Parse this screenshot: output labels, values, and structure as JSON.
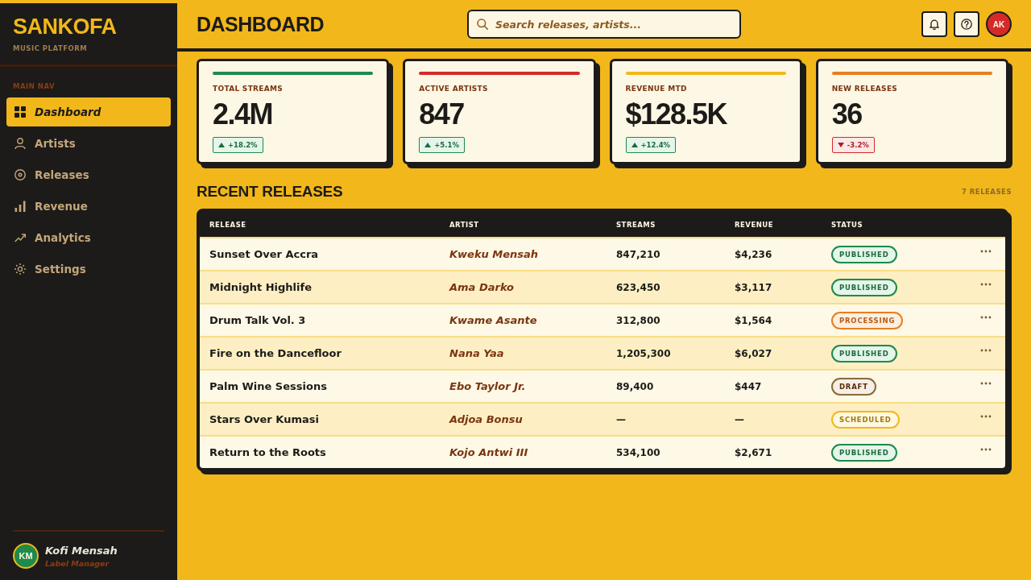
{
  "sidebar": {
    "brand": {
      "name": "SANKOFA",
      "tagline": "MUSIC PLATFORM"
    },
    "nav_heading": "MAIN NAV",
    "nav_items": [
      {
        "label": "Dashboard",
        "selected": true
      },
      {
        "label": "Artists",
        "selected": false
      },
      {
        "label": "Releases",
        "selected": false
      },
      {
        "label": "Revenue",
        "selected": false
      },
      {
        "label": "Analytics",
        "selected": false
      },
      {
        "label": "Settings",
        "selected": false
      }
    ],
    "user": {
      "initials": "KM",
      "name": "Kofi Mensah",
      "role": "Label Manager"
    }
  },
  "header": {
    "title": "DASHBOARD",
    "search": {
      "placeholder": "Search releases, artists..."
    },
    "user_initials": "AK"
  },
  "stats": [
    {
      "label": "TOTAL STREAMS",
      "value": "2.4M",
      "color": "#1e8a4c",
      "delta": {
        "text": "+18.2%",
        "kind": "up"
      }
    },
    {
      "label": "ACTIVE ARTISTS",
      "value": "847",
      "color": "#d42a2a",
      "delta": {
        "text": "+5.1%",
        "kind": "up"
      }
    },
    {
      "label": "REVENUE MTD",
      "value": "$128.5K",
      "color": "#f2b71a",
      "delta": {
        "text": "+12.4%",
        "kind": "up"
      }
    },
    {
      "label": "NEW RELEASES",
      "value": "36",
      "color": "#e67e22",
      "delta": {
        "text": "-3.2%",
        "kind": "down"
      }
    }
  ],
  "recent_releases": {
    "title": "RECENT RELEASES",
    "count": "7 RELEASES",
    "table": {
      "columns": [
        "RELEASE",
        "ARTIST",
        "STREAMS",
        "REVENUE",
        "STATUS"
      ],
      "rows": [
        {
          "release": "Sunset Over Accra",
          "artist": "Kweku Mensah",
          "streams": "847,210",
          "revenue": "$4,236",
          "status": {
            "label": "PUBLISHED",
            "kind": "published"
          }
        },
        {
          "release": "Midnight Highlife",
          "artist": "Ama Darko",
          "streams": "623,450",
          "revenue": "$3,117",
          "status": {
            "label": "PUBLISHED",
            "kind": "published"
          }
        },
        {
          "release": "Drum Talk Vol. 3",
          "artist": "Kwame Asante",
          "streams": "312,800",
          "revenue": "$1,564",
          "status": {
            "label": "PROCESSING",
            "kind": "processing"
          }
        },
        {
          "release": "Fire on the Dancefloor",
          "artist": "Nana Yaa",
          "streams": "1,205,300",
          "revenue": "$6,027",
          "status": {
            "label": "PUBLISHED",
            "kind": "published"
          }
        },
        {
          "release": "Palm Wine Sessions",
          "artist": "Ebo Taylor Jr.",
          "streams": "89,400",
          "revenue": "$447",
          "status": {
            "label": "DRAFT",
            "kind": "draft"
          }
        },
        {
          "release": "Stars Over Kumasi",
          "artist": "Adjoa Bonsu",
          "streams": "—",
          "revenue": "—",
          "status": {
            "label": "SCHEDULED",
            "kind": "scheduled"
          }
        },
        {
          "release": "Return to the Roots",
          "artist": "Kojo Antwi III",
          "streams": "534,100",
          "revenue": "$2,671",
          "status": {
            "label": "PUBLISHED",
            "kind": "published"
          }
        }
      ]
    }
  }
}
